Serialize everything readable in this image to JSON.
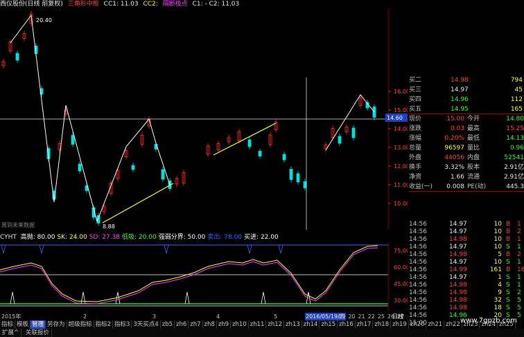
{
  "header": {
    "title": "西仪股份(日线 前复权)",
    "line2": "三角形中枢",
    "cc1": "CC1: 11.03",
    "cc2": "CC2:",
    "mark": "隔断极点",
    "c1c2": "C1: - C2: 11.03"
  },
  "main_chart": {
    "high_label": "20.40",
    "low_label": "8.88",
    "prediction_label": "周到未来数据",
    "price_ticks": [
      "16.00",
      "15.00",
      "14.00",
      "13.00",
      "12.00",
      "11.00",
      "10.00"
    ],
    "crosshair_price": "14.60",
    "colors": {
      "up": "#ff3030",
      "down": "#00e0e0",
      "bg": "#000000",
      "line": "#ffff40"
    }
  },
  "indicator": {
    "name": "CYHT",
    "items": [
      {
        "label": "高抛: 80.00",
        "color": "#ffffff"
      },
      {
        "label": "SK: 24.00",
        "color": "#ffff40"
      },
      {
        "label": "SD: 27.38",
        "color": "#ff40ff"
      },
      {
        "label": "低吸: 20.00",
        "color": "#40ff40"
      },
      {
        "label": "强弱分界: 50.00",
        "color": "#ffffff"
      },
      {
        "label": "卖出: 78.00",
        "color": "#4060ff"
      },
      {
        "label": "买进: 22.00",
        "color": "#ffffff"
      }
    ],
    "ticks": [
      "75.00",
      "60.00",
      "45.00",
      "30.00"
    ]
  },
  "date_axis": {
    "labels": [
      "2015年",
      "2",
      "3",
      "4",
      "5"
    ],
    "selected_date": "2016/05/19/四",
    "right_numbers": [
      "19",
      "20",
      "21",
      "22",
      "25",
      "26",
      "27"
    ],
    "right_label": "日线"
  },
  "tabs": [
    "指标",
    "模板",
    "管理",
    "另存为",
    "超级指标",
    "指标2",
    "指标3",
    "3天买点4",
    "zb5",
    "zh6",
    "zh7",
    "zh8",
    "zh9",
    "zh10",
    "zh11",
    "zh12",
    "zh13",
    "zh14",
    "zh15",
    "zh16",
    "zh17",
    "zh18",
    "zh19",
    "zh20",
    "zh21",
    "zh22",
    "zh23",
    "zh24",
    "zh25"
  ],
  "active_tab": 2,
  "bottom_tabs": [
    "扩展^",
    "关联报价"
  ],
  "quote_panel": {
    "bids": [
      {
        "label": "买二",
        "price": "14.98",
        "vol": "794",
        "pc": "red"
      },
      {
        "label": "买三",
        "price": "14.97",
        "vol": "45",
        "pc": "wht"
      },
      {
        "label": "买四",
        "price": "14.96",
        "vol": "112",
        "pc": "grn"
      },
      {
        "label": "买五",
        "price": "14.95",
        "vol": "165",
        "pc": "grn"
      }
    ],
    "stats": [
      {
        "l1": "现价",
        "v1": "15.00",
        "c1": "red",
        "l2": "今开",
        "v2": "14.80",
        "c2": "grn"
      },
      {
        "l1": "涨跌",
        "v1": "0.03",
        "c1": "red",
        "l2": "最高",
        "v2": "15.25",
        "c2": "red"
      },
      {
        "l1": "涨幅",
        "v1": "0.20%",
        "c1": "red",
        "l2": "最低",
        "v2": "14.13",
        "c2": "grn"
      },
      {
        "l1": "总量",
        "v1": "96597",
        "c1": "yel",
        "l2": "量比",
        "v2": "0.96",
        "c2": "grn"
      },
      {
        "l1": "外盘",
        "v1": "44056",
        "c1": "red",
        "l2": "内盘",
        "v2": "52541",
        "c2": "grn"
      },
      {
        "l1": "换手",
        "v1": "3.32%",
        "c1": "wht",
        "l2": "股本",
        "v2": "2.91亿",
        "c2": "wht"
      },
      {
        "l1": "净资",
        "v1": "1.66",
        "c1": "wht",
        "l2": "流通",
        "v2": "2.91亿",
        "c2": "wht"
      },
      {
        "l1": "收益(一)",
        "v1": "0.008",
        "c1": "wht",
        "l2": "PE(动)",
        "v2": "445.3",
        "c2": "wht"
      }
    ],
    "ticks": [
      {
        "time": "14:56",
        "price": "14.97",
        "pc": "wht",
        "vol": "10",
        "side": "B",
        "sc": "red",
        "n": "1"
      },
      {
        "time": "14:56",
        "price": "14.97",
        "pc": "wht",
        "vol": "10",
        "side": "B",
        "sc": "red",
        "n": "2"
      },
      {
        "time": "14:56",
        "price": "14.98",
        "pc": "red",
        "vol": "10",
        "side": "B",
        "sc": "red",
        "n": "1"
      },
      {
        "time": "14:56",
        "price": "14.97",
        "pc": "wht",
        "vol": "10",
        "side": "S",
        "sc": "grn",
        "n": "1"
      },
      {
        "time": "14:56",
        "price": "14.98",
        "pc": "red",
        "vol": "5",
        "side": "B",
        "sc": "red",
        "n": "2"
      },
      {
        "time": "14:56",
        "price": "14.97",
        "pc": "wht",
        "vol": "10",
        "side": "S",
        "sc": "grn",
        "n": "1"
      },
      {
        "time": "14:56",
        "price": "14.99",
        "pc": "red",
        "vol": "161",
        "side": "B",
        "sc": "red",
        "n": "16"
      },
      {
        "time": "14:56",
        "price": "14.97",
        "pc": "wht",
        "vol": "1",
        "side": "S",
        "sc": "grn",
        "n": "1"
      },
      {
        "time": "14:56",
        "price": "14.98",
        "pc": "red",
        "vol": "4",
        "side": "S",
        "sc": "grn",
        "n": "1"
      },
      {
        "time": "14:56",
        "price": "14.98",
        "pc": "red",
        "vol": "9",
        "side": "S",
        "sc": "grn",
        "n": "2"
      },
      {
        "time": "14:56",
        "price": "14.98",
        "pc": "red",
        "vol": "32",
        "side": "S",
        "sc": "grn",
        "n": "5"
      },
      {
        "time": "14:56",
        "price": "14.98",
        "pc": "red",
        "vol": "18",
        "side": "S",
        "sc": "grn",
        "n": "5"
      },
      {
        "time": "14:56",
        "price": "14.96",
        "pc": "grn",
        "vol": "20",
        "side": "S",
        "sc": "grn",
        "n": "5"
      },
      {
        "time": "15:00",
        "price": "",
        "pc": "wht",
        "vol": "",
        "side": "",
        "sc": "grn",
        "n": ""
      }
    ]
  },
  "watermark": "www.7gpzb.com"
}
